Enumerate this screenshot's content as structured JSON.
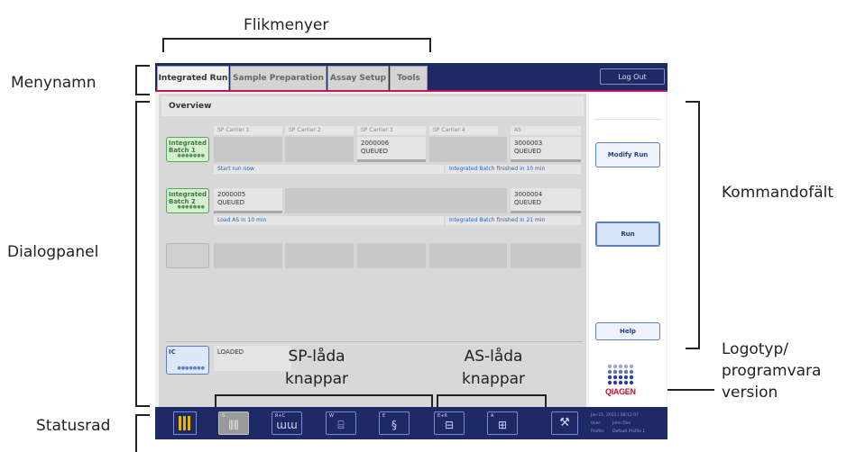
{
  "annotations": {
    "flikmenyer": "Flikmenyer",
    "menynamn": "Menynamn",
    "dialogpanel": "Dialogpanel",
    "statusrad": "Statusrad",
    "kommandofalt": "Kommandofält",
    "logotyp_line1": "Logotyp/",
    "logotyp_line2": "programvara",
    "logotyp_line3": "version",
    "sp_lada_line1": "SP-låda",
    "sp_lada_line2": "knappar",
    "as_lada_line1": "AS-låda",
    "as_lada_line2": "knappar"
  },
  "menubar": {
    "tabs": [
      "Integrated Run",
      "Sample Preparation",
      "Assay Setup",
      "Tools"
    ],
    "active_tab": "Integrated Run",
    "logout_label": "Log Out"
  },
  "dialog": {
    "title": "Overview",
    "columns": [
      "SP Carrier 1",
      "SP Carrier 2",
      "SP Carrier 3",
      "SP Carrier 4",
      "AS"
    ],
    "batches": [
      {
        "label_line1": "Integrated",
        "label_line2": "Batch 1",
        "sp_job": {
          "id": "2000006",
          "status": "QUEUED"
        },
        "as_job": {
          "id": "3000003",
          "status": "QUEUED"
        },
        "info_left": "Start run now",
        "info_right": "Integrated Batch finished in 10 min"
      },
      {
        "label_line1": "Integrated",
        "label_line2": "Batch 2",
        "sp_job": {
          "id": "2000005",
          "status": "QUEUED"
        },
        "as_job": {
          "id": "3000004",
          "status": "QUEUED"
        },
        "info_left": "Load AS in 10 min",
        "info_right": "Integrated Batch finished in 21 min"
      }
    ],
    "ic": {
      "label": "IC",
      "status": "LOADED"
    }
  },
  "command_bar": {
    "modify_run": "Modify Run",
    "run": "Run",
    "help": "Help"
  },
  "logo": {
    "text": "QIAGEN"
  },
  "statusbar": {
    "buttons": [
      {
        "label": "S",
        "icon": "sample-rack-icon"
      },
      {
        "label": "R+C",
        "icon": "reagent-cartridge-icon"
      },
      {
        "label": "W",
        "icon": "waste-bin-icon"
      },
      {
        "label": "E",
        "icon": "eluate-tube-icon"
      },
      {
        "label": "E+R",
        "icon": "eluate-reagent-rack-icon"
      },
      {
        "label": "A",
        "icon": "assay-rack-icon"
      }
    ],
    "tools_icon": "tools-icon",
    "date_line": "Jan 21, 2015 | 08:12:07",
    "user_label": "User:",
    "user_value": "John Doe",
    "profile_label": "Profile:",
    "profile_value": "Default Profile 1"
  }
}
